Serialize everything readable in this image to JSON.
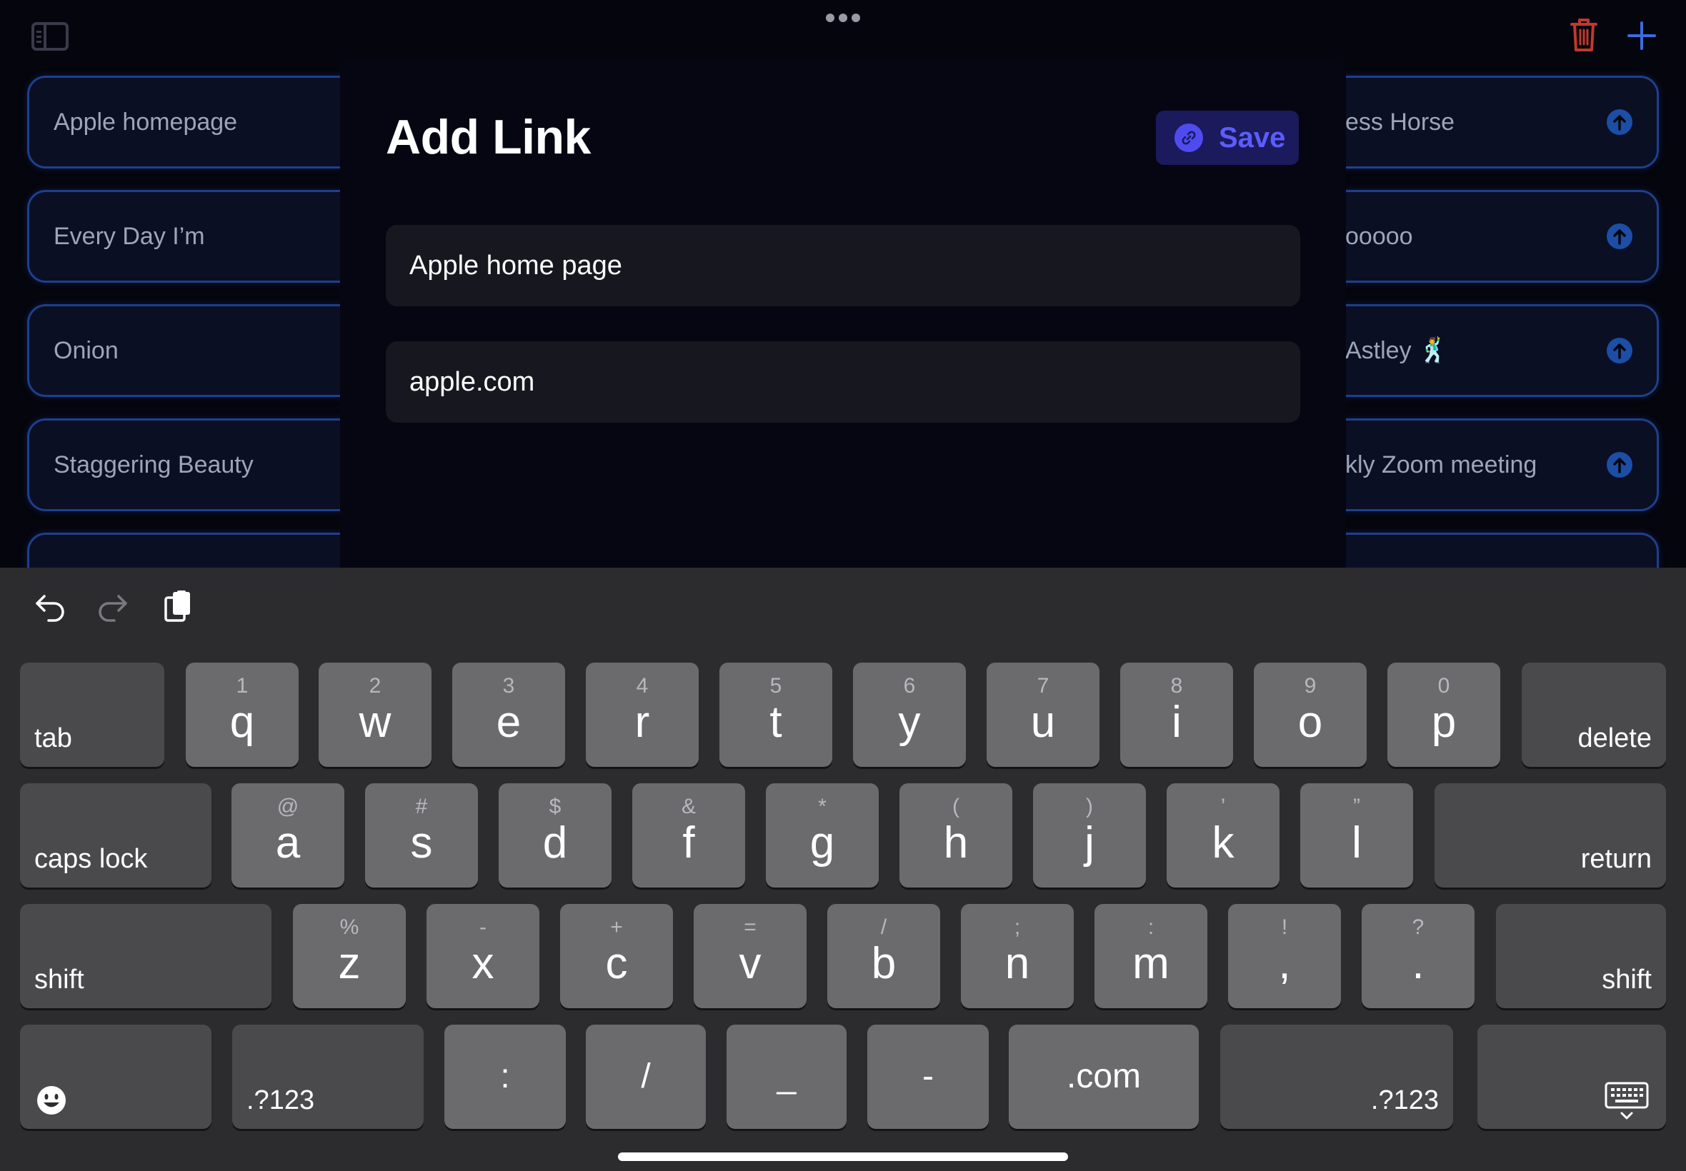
{
  "links_left": [
    {
      "title": "Apple homepage"
    },
    {
      "title": "Every Day I’m"
    },
    {
      "title": "Onion"
    },
    {
      "title": "Staggering Beauty"
    }
  ],
  "links_right": [
    {
      "title": "ess Horse"
    },
    {
      "title": "ooooo"
    },
    {
      "title": "Astley 🕺"
    },
    {
      "title": "kly Zoom meeting"
    }
  ],
  "sheet": {
    "title": "Add Link",
    "save_label": "Save",
    "name_value": "Apple home page",
    "url_value": "apple.com"
  },
  "keyboard": {
    "row1": [
      {
        "sec": "1",
        "pri": "q"
      },
      {
        "sec": "2",
        "pri": "w"
      },
      {
        "sec": "3",
        "pri": "e"
      },
      {
        "sec": "4",
        "pri": "r"
      },
      {
        "sec": "5",
        "pri": "t"
      },
      {
        "sec": "6",
        "pri": "y"
      },
      {
        "sec": "7",
        "pri": "u"
      },
      {
        "sec": "8",
        "pri": "i"
      },
      {
        "sec": "9",
        "pri": "o"
      },
      {
        "sec": "0",
        "pri": "p"
      }
    ],
    "row2": [
      {
        "sec": "@",
        "pri": "a"
      },
      {
        "sec": "#",
        "pri": "s"
      },
      {
        "sec": "$",
        "pri": "d"
      },
      {
        "sec": "&",
        "pri": "f"
      },
      {
        "sec": "*",
        "pri": "g"
      },
      {
        "sec": "(",
        "pri": "h"
      },
      {
        "sec": ")",
        "pri": "j"
      },
      {
        "sec": "’",
        "pri": "k"
      },
      {
        "sec": "”",
        "pri": "l"
      }
    ],
    "row3": [
      {
        "sec": "%",
        "pri": "z"
      },
      {
        "sec": "-",
        "pri": "x"
      },
      {
        "sec": "+",
        "pri": "c"
      },
      {
        "sec": "=",
        "pri": "v"
      },
      {
        "sec": "/",
        "pri": "b"
      },
      {
        "sec": ";",
        "pri": "n"
      },
      {
        "sec": ":",
        "pri": "m"
      },
      {
        "sec": "!",
        "pri": ","
      },
      {
        "sec": "?",
        "pri": "."
      }
    ],
    "row4": [
      ":",
      "/",
      "_",
      "-"
    ],
    "tab": "tab",
    "delete": "delete",
    "caps_lock": "caps lock",
    "return": "return",
    "shift": "shift",
    "numbers": ".?123",
    "dotcom": ".com"
  },
  "colors": {
    "accent": "#5c5cff",
    "card_border": "#1e3f8c",
    "trash": "#c0392b",
    "plus": "#3a6be0"
  }
}
